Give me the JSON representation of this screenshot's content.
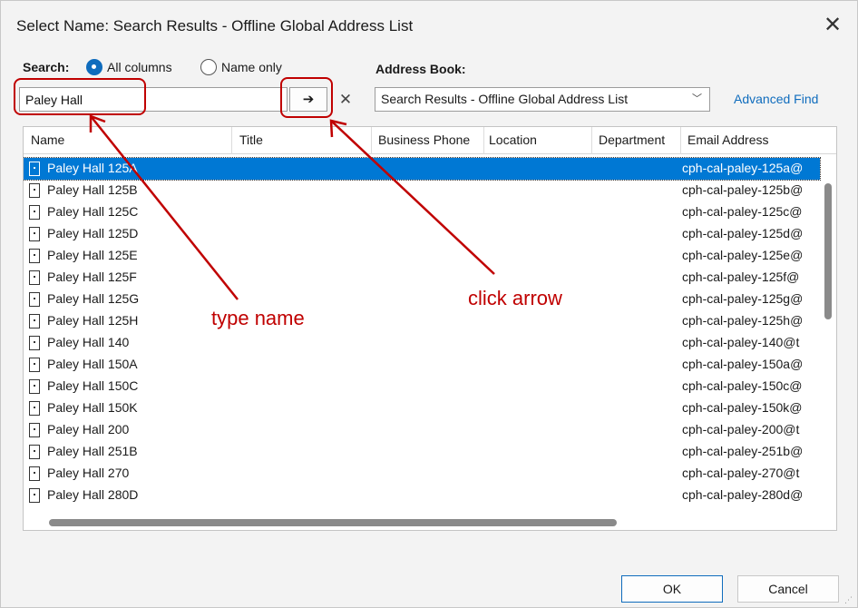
{
  "window": {
    "title": "Select Name: Search Results - Offline Global Address List",
    "close_glyph": "✕"
  },
  "search": {
    "label": "Search:",
    "radio_all": "All columns",
    "radio_name": "Name only",
    "value": "Paley Hall",
    "go_glyph": "➔",
    "clear_glyph": "✕"
  },
  "address_book": {
    "label": "Address Book:",
    "selected": "Search Results - Offline Global Address List",
    "chevron": "﹀",
    "advanced_find": "Advanced Find"
  },
  "columns": [
    "Name",
    "Title",
    "Business Phone",
    "Location",
    "Department",
    "Email Address"
  ],
  "rows": [
    {
      "name": "Paley Hall 125A",
      "email": "cph-cal-paley-125a@"
    },
    {
      "name": "Paley Hall 125B",
      "email": "cph-cal-paley-125b@"
    },
    {
      "name": "Paley Hall 125C",
      "email": "cph-cal-paley-125c@"
    },
    {
      "name": "Paley Hall 125D",
      "email": "cph-cal-paley-125d@"
    },
    {
      "name": "Paley Hall 125E",
      "email": "cph-cal-paley-125e@"
    },
    {
      "name": "Paley Hall 125F",
      "email": "cph-cal-paley-125f@"
    },
    {
      "name": "Paley Hall 125G",
      "email": "cph-cal-paley-125g@"
    },
    {
      "name": "Paley Hall 125H",
      "email": "cph-cal-paley-125h@"
    },
    {
      "name": "Paley Hall 140",
      "email": "cph-cal-paley-140@t"
    },
    {
      "name": "Paley Hall 150A",
      "email": "cph-cal-paley-150a@"
    },
    {
      "name": "Paley Hall 150C",
      "email": "cph-cal-paley-150c@"
    },
    {
      "name": "Paley Hall 150K",
      "email": "cph-cal-paley-150k@"
    },
    {
      "name": "Paley Hall 200",
      "email": "cph-cal-paley-200@t"
    },
    {
      "name": "Paley Hall 251B",
      "email": "cph-cal-paley-251b@"
    },
    {
      "name": "Paley Hall 270",
      "email": "cph-cal-paley-270@t"
    },
    {
      "name": "Paley Hall 280D",
      "email": "cph-cal-paley-280d@"
    }
  ],
  "selected_row_index": 0,
  "buttons": {
    "ok": "OK",
    "cancel": "Cancel"
  },
  "annotations": {
    "type_name": "type name",
    "click_arrow": "click arrow",
    "color": "#c00000"
  },
  "colors": {
    "selection": "#0078d4",
    "link": "#0f6cbd",
    "annotation": "#c00000"
  }
}
